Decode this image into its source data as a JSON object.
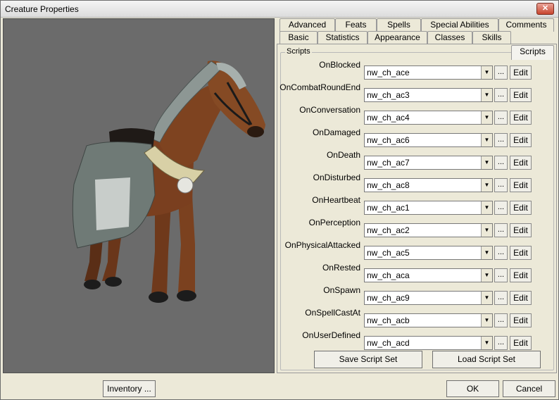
{
  "window": {
    "title": "Creature Properties",
    "close_label": "✕"
  },
  "tabs_row1": [
    {
      "label": "Advanced"
    },
    {
      "label": "Feats"
    },
    {
      "label": "Spells"
    },
    {
      "label": "Special Abilities"
    },
    {
      "label": "Comments"
    }
  ],
  "tabs_row2": [
    {
      "label": "Basic"
    },
    {
      "label": "Statistics"
    },
    {
      "label": "Appearance"
    },
    {
      "label": "Classes"
    },
    {
      "label": "Skills"
    },
    {
      "label": "Scripts"
    }
  ],
  "active_tab": "Scripts",
  "scripts_group": {
    "label": "Scripts",
    "dots_label": "...",
    "edit_label": "Edit",
    "rows": [
      {
        "event": "OnBlocked",
        "script": "nw_ch_ace"
      },
      {
        "event": "OnCombatRoundEnd",
        "script": "nw_ch_ac3"
      },
      {
        "event": "OnConversation",
        "script": "nw_ch_ac4"
      },
      {
        "event": "OnDamaged",
        "script": "nw_ch_ac6"
      },
      {
        "event": "OnDeath",
        "script": "nw_ch_ac7"
      },
      {
        "event": "OnDisturbed",
        "script": "nw_ch_ac8"
      },
      {
        "event": "OnHeartbeat",
        "script": "nw_ch_ac1"
      },
      {
        "event": "OnPerception",
        "script": "nw_ch_ac2"
      },
      {
        "event": "OnPhysicalAttacked",
        "script": "nw_ch_ac5"
      },
      {
        "event": "OnRested",
        "script": "nw_ch_aca"
      },
      {
        "event": "OnSpawn",
        "script": "nw_ch_ac9"
      },
      {
        "event": "OnSpellCastAt",
        "script": "nw_ch_acb"
      },
      {
        "event": "OnUserDefined",
        "script": "nw_ch_acd"
      }
    ],
    "save_label": "Save Script Set",
    "load_label": "Load Script Set"
  },
  "footer": {
    "inventory_label": "Inventory ...",
    "ok_label": "OK",
    "cancel_label": "Cancel"
  },
  "colors": {
    "window_bg": "#ece9d8",
    "viewport_bg": "#6b6b6b",
    "horse_coat": "#7a3f1f",
    "barding": "#6f7a76"
  }
}
